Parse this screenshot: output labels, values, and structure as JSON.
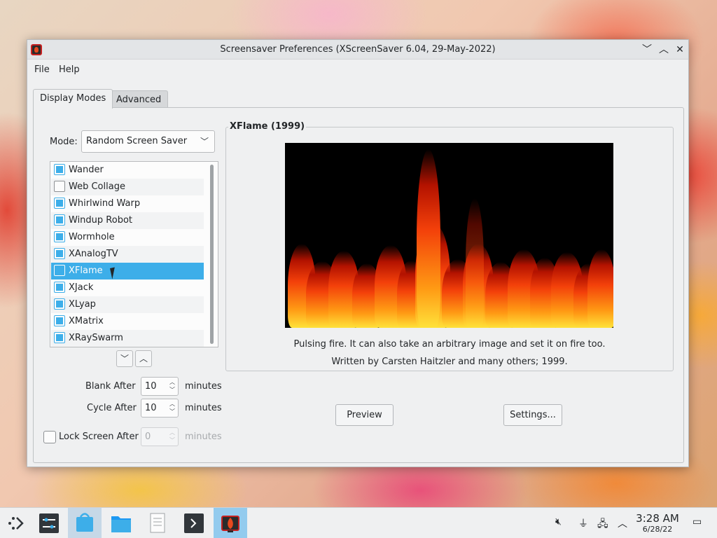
{
  "window": {
    "title": "Screensaver Preferences (XScreenSaver 6.04, 29-May-2022)",
    "controls": {
      "minimize": "﹀",
      "maximize": "︿",
      "close": "✕"
    }
  },
  "menubar": {
    "file": "File",
    "help": "Help"
  },
  "tabs": [
    {
      "label": "Display Modes",
      "active": true
    },
    {
      "label": "Advanced",
      "active": false
    }
  ],
  "mode": {
    "label": "Mode:",
    "selected": "Random Screen Saver"
  },
  "savers": [
    {
      "name": "Wander",
      "checked": true
    },
    {
      "name": "Web Collage",
      "checked": false
    },
    {
      "name": "Whirlwind Warp",
      "checked": true
    },
    {
      "name": "Windup Robot",
      "checked": true
    },
    {
      "name": "Wormhole",
      "checked": true
    },
    {
      "name": "XAnalogTV",
      "checked": true
    },
    {
      "name": "XFlame",
      "checked": true,
      "selected": true
    },
    {
      "name": "XJack",
      "checked": true
    },
    {
      "name": "XLyap",
      "checked": true
    },
    {
      "name": "XMatrix",
      "checked": true
    },
    {
      "name": "XRaySwarm",
      "checked": true
    }
  ],
  "arrows": {
    "down": "﹀",
    "up": "︿"
  },
  "timing": {
    "blank_label": "Blank After",
    "blank_value": "10",
    "cycle_label": "Cycle After",
    "cycle_value": "10",
    "lock_label": "Lock Screen After",
    "lock_value": "0",
    "units": "minutes"
  },
  "preview_panel": {
    "title": "XFlame (1999)",
    "description": "Pulsing fire. It can also take an arbitrary image and set it on fire too.",
    "credits": "Written by Carsten Haitzler and many others; 1999."
  },
  "buttons": {
    "preview": "Preview",
    "settings": "Settings..."
  },
  "taskbar": {
    "clock_time": "3:28 AM",
    "clock_date": "6/28/22"
  },
  "colors": {
    "accent": "#3daee9",
    "window_bg": "#eff0f1"
  }
}
